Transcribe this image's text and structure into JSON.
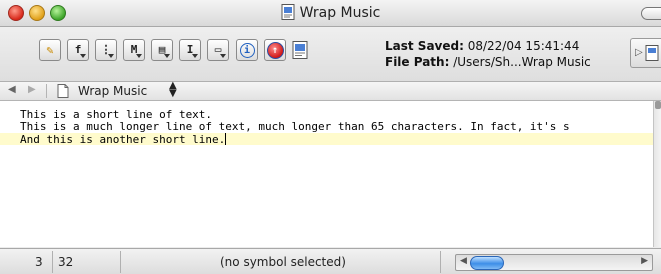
{
  "window": {
    "title": "Wrap Music",
    "icon": "document-icon"
  },
  "toolbar": {
    "buttons": [
      {
        "name": "pencil-icon",
        "glyph": "✎"
      },
      {
        "name": "function-menu-icon",
        "glyph": "f"
      },
      {
        "name": "list-menu-icon",
        "glyph": "⋮"
      },
      {
        "name": "marker-menu-icon",
        "glyph": "M"
      },
      {
        "name": "document-menu-icon",
        "glyph": "▤"
      },
      {
        "name": "text-cursor-menu-icon",
        "glyph": "I"
      },
      {
        "name": "window-icon",
        "glyph": "▭"
      },
      {
        "name": "info-icon",
        "glyph": "i"
      },
      {
        "name": "bbedit-icon",
        "glyph": "↑"
      },
      {
        "name": "document-icon",
        "glyph": ""
      }
    ],
    "last_saved_label": "Last Saved:",
    "last_saved_value": "08/22/04 15:41:44",
    "file_path_label": "File Path:",
    "file_path_value": "/Users/Sh...Wrap Music"
  },
  "navbar": {
    "back_glyph": "◀",
    "forward_glyph": "▶",
    "file_label": "Wrap Music",
    "stepper_glyph": "▲▼"
  },
  "editor": {
    "lines": [
      "This is a short line of text.",
      "This is a much longer line of text, much longer than 65 characters. In fact, it's s",
      "And this is another short line."
    ],
    "current_line_highlight": "#fffbcc"
  },
  "status": {
    "line": "3",
    "column": "32",
    "symbol": "(no symbol selected)",
    "scroll_left_glyph": "◀",
    "scroll_right_glyph": "▶"
  },
  "colors": {
    "close": "#d8281a",
    "minimize": "#e0a01a",
    "zoom": "#3ea52a",
    "scroll_knob": "#3d8ee8"
  }
}
